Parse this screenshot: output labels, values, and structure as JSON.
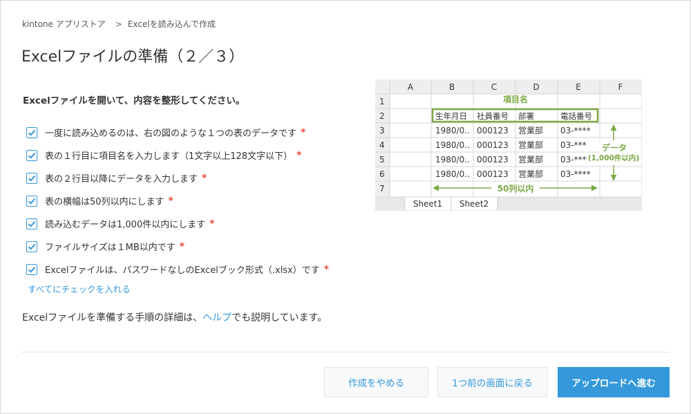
{
  "breadcrumb": {
    "app_store": "kintone アプリストア",
    "separator": ">",
    "current": "Excelを読み込んで作成"
  },
  "page_title": "Excelファイルの準備（２／３）",
  "intro": "Excelファイルを開いて、内容を整形してください。",
  "checklist": [
    {
      "label": "一度に読み込めるのは、右の図のような１つの表のデータです",
      "checked": true,
      "required": "*"
    },
    {
      "label": "表の１行目に項目名を入力します（1文字以上128文字以下）",
      "checked": true,
      "required": "*"
    },
    {
      "label": "表の２行目以降にデータを入力します",
      "checked": true,
      "required": "*"
    },
    {
      "label": "表の横幅は50列以内にします",
      "checked": true,
      "required": "*"
    },
    {
      "label": "読み込むデータは1,000件以内にします",
      "checked": true,
      "required": "*"
    },
    {
      "label": "ファイルサイズは１MB以内です",
      "checked": true,
      "required": "*"
    },
    {
      "label": "Excelファイルは、パスワードなしのExcelブック形式（.xlsx）です",
      "checked": true,
      "required": "*"
    }
  ],
  "check_all": "すべてにチェックを入れる",
  "note": {
    "before": "Excelファイルを準備する手順の詳細は、",
    "link": "ヘルプ",
    "after": "でも説明しています。"
  },
  "buttons": {
    "cancel": "作成をやめる",
    "back": "1つ前の画面に戻る",
    "next": "アップロードへ進む"
  },
  "sheet": {
    "columns": [
      "A",
      "B",
      "C",
      "D",
      "E",
      "F"
    ],
    "rows": [
      "1",
      "2",
      "3",
      "4",
      "5",
      "6",
      "7"
    ],
    "header_label": "項目名",
    "headers": [
      "生年月日",
      "社員番号",
      "部署",
      "電話番号"
    ],
    "data_rows": [
      [
        "1980/0..",
        "000123",
        "営業部",
        "03-****"
      ],
      [
        "1980/0..",
        "000123",
        "営業部",
        "03-***"
      ],
      [
        "1980/0..",
        "000123",
        "営業部",
        "03-***"
      ],
      [
        "1980/0..",
        "000123",
        "営業部",
        "03-****"
      ]
    ],
    "data_label": "データ",
    "data_limit": "(1,000件以内)",
    "width_label": "50列以内",
    "tabs": [
      "Sheet1",
      "Sheet2"
    ]
  },
  "colors": {
    "accent": "#3498db",
    "required": "#e74c3c",
    "annotation": "#7aa843"
  }
}
